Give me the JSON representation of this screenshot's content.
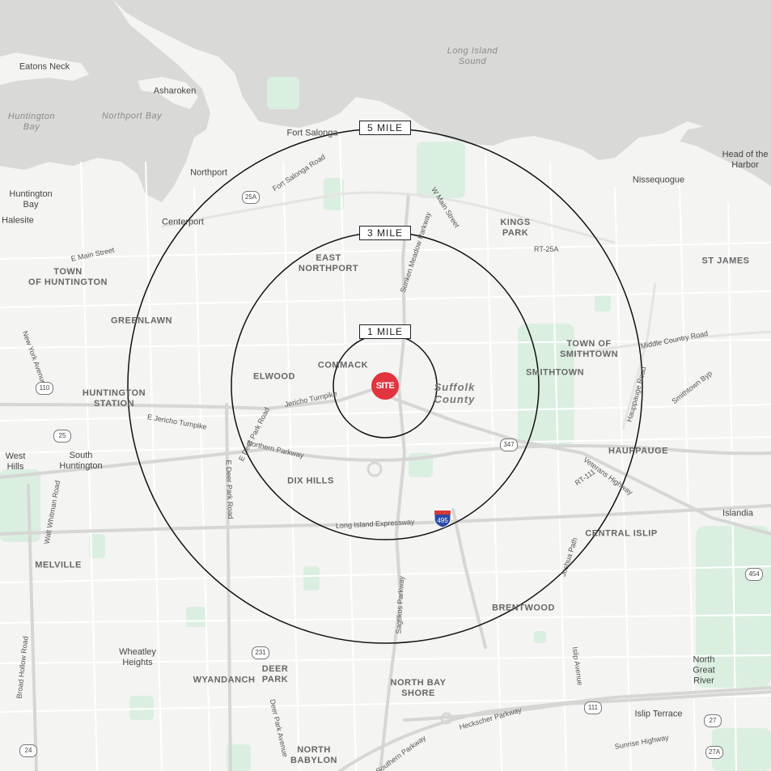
{
  "site_marker": {
    "label": "SITE",
    "color": "#e2343e"
  },
  "rings": [
    {
      "label": "1 MILE"
    },
    {
      "label": "3 MILE"
    },
    {
      "label": "5 MILE"
    }
  ],
  "water": {
    "sound": "Long Island\nSound",
    "huntington_bay": "Huntington\nBay",
    "northport_bay": "Northport Bay"
  },
  "county": "Suffolk\nCounty",
  "places": {
    "eatons_neck": "Eatons Neck",
    "asharoken": "Asharoken",
    "fort_salonga": "Fort Salonga",
    "northport": "Northport",
    "huntington_bay_village": "Huntington\nBay",
    "halesite": "Halesite",
    "centerport": "Centerport",
    "head_of_harbor": "Head of the\nHarbor",
    "nissequogue": "Nissequogue",
    "west_hills": "West\nHills",
    "south_huntington": "South\nHuntington",
    "islandia": "Islandia",
    "wheatley_heights": "Wheatley\nHeights",
    "islip_terrace": "Islip Terrace",
    "north_great_river": "North\nGreat\nRiver"
  },
  "districts": {
    "kings_park": "KINGS\nPARK",
    "east_northport": "EAST\nNORTHPORT",
    "st_james": "ST JAMES",
    "town_of_huntington": "TOWN\nOF HUNTINGTON",
    "greenlawn": "GREENLAWN",
    "town_of_smithtown": "TOWN OF\nSMITHTOWN",
    "commack": "COMMACK",
    "elwood": "ELWOOD",
    "smithtown": "SMITHTOWN",
    "huntington_station": "HUNTINGTON\nSTATION",
    "hauppauge": "HAUPPAUGE",
    "dix_hills": "DIX HILLS",
    "central_islip": "CENTRAL ISLIP",
    "melville": "MELVILLE",
    "brentwood": "BRENTWOOD",
    "wyandanch": "WYANDANCH",
    "deer_park": "DEER\nPARK",
    "north_bay_shore": "NORTH BAY\nSHORE",
    "north_babylon": "NORTH\nBABYLON"
  },
  "roads": {
    "fort_salonga_road": "Fort Salonga Road",
    "w_main_street": "W Main Street",
    "sunken_meadow_parkway": "Sunken Meadow Parkway",
    "e_main_street": "E Main Street",
    "rt_25a": "RT-25A",
    "middle_country_road": "Middle Country Road",
    "new_york_avenue": "New York Avenue",
    "smithtown_byp": "Smithtown Byp",
    "jericho_turnpike": "Jericho Turnpike",
    "hauppauge_road": "Hauppauge Road",
    "e_jericho_turnpike": "E Jericho Turnpike",
    "e_deer_park_road": "E Deer Park Road",
    "northern_parkway": "Northern Parkway",
    "veterans_highway": "Veterans Highway",
    "rt_111": "RT-111",
    "e_deer_park_road_2": "E Deer Park Road",
    "walt_whitman_road": "Walt Whitman Road",
    "long_island_expressway": "Long Island Expressway",
    "joshua_path": "Joshua Path",
    "sagtikos_parkway": "Sagtikos Parkway",
    "broad_hollow_road": "Broad Hollow Road",
    "islip_avenue": "Islip Avenue",
    "heckscher_parkway": "Heckscher Parkway",
    "deer_park_avenue": "Deer Park Avenue",
    "sunrise_highway": "Sunrise Highway",
    "southern_parkway": "Southern Parkway"
  },
  "shields": {
    "s25a": "25A",
    "s110": "110",
    "s25": "25",
    "s347": "347",
    "s454": "454",
    "s231": "231",
    "s111": "111",
    "s27": "27",
    "s24": "24",
    "s27a": "27A"
  },
  "interstate": "495"
}
